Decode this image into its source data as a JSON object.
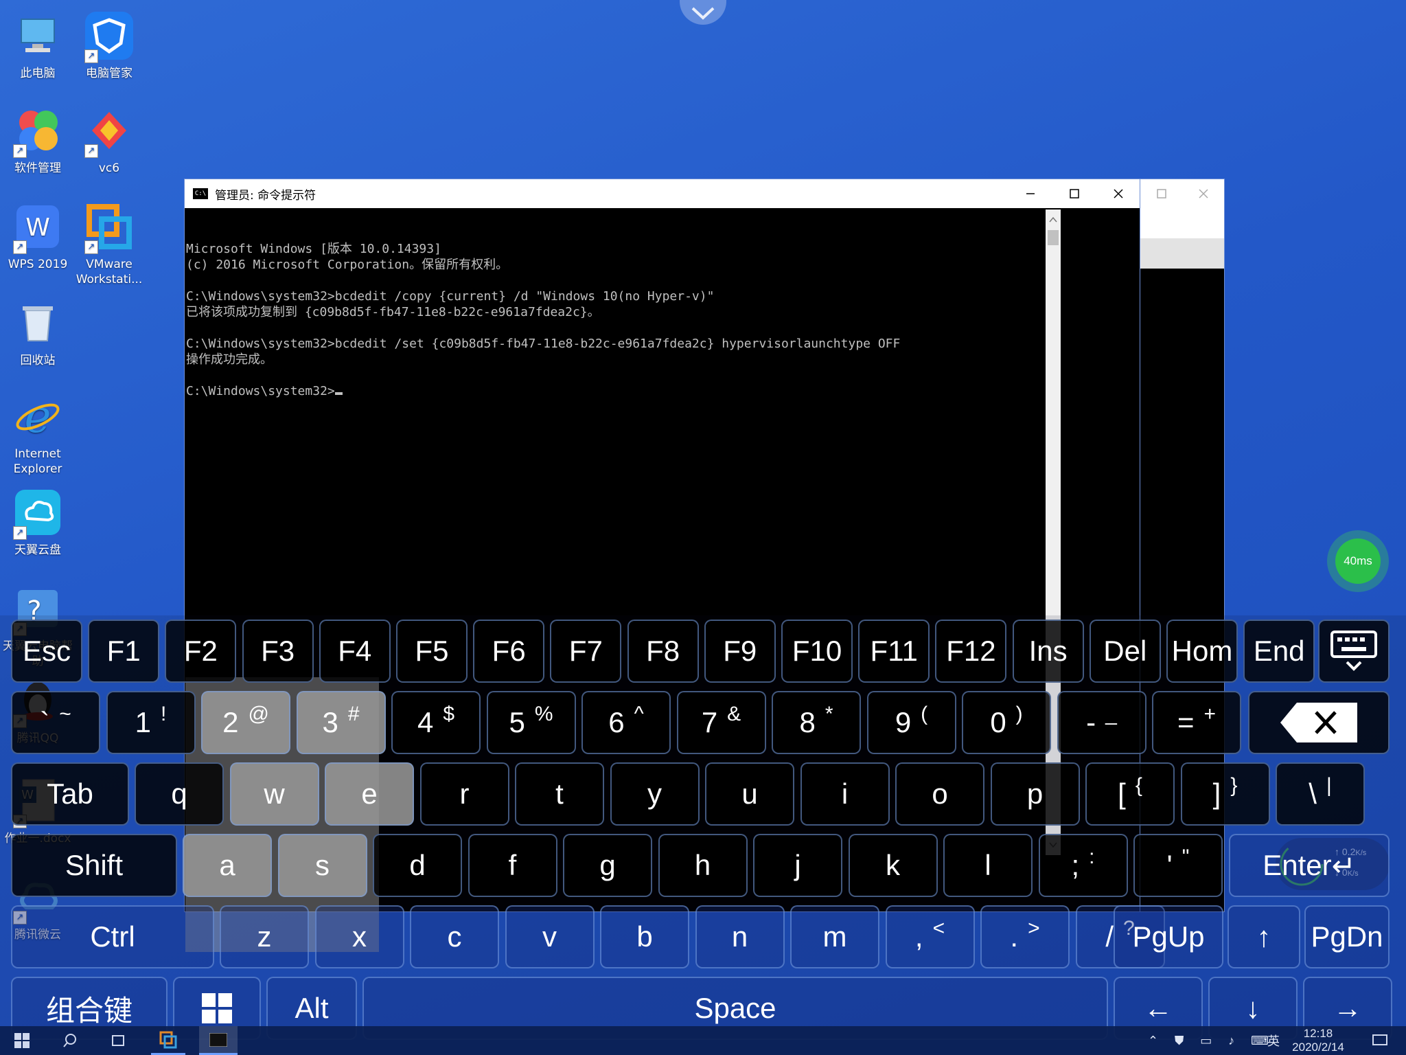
{
  "desktop": {
    "icons": [
      {
        "label": "此电脑"
      },
      {
        "label": "电脑管家"
      },
      {
        "label": "软件管理"
      },
      {
        "label": "vc6"
      },
      {
        "label": "WPS 2019"
      },
      {
        "label": "VMware Workstati..."
      },
      {
        "label": "回收站"
      },
      {
        "label": "Internet Explorer"
      },
      {
        "label": "天翼云盘"
      },
      {
        "label": "天翼云电脑帮助"
      },
      {
        "label": "腾讯QQ"
      },
      {
        "label": "作业一.docx"
      },
      {
        "label": "腾讯微云"
      }
    ]
  },
  "cmd_window": {
    "title": "管理员: 命令提示符",
    "lines": [
      "Microsoft Windows [版本 10.0.14393]",
      "(c) 2016 Microsoft Corporation。保留所有权利。",
      "",
      "C:\\Windows\\system32>bcdedit /copy {current} /d \"Windows 10(no Hyper-v)\"",
      "已将该项成功复制到 {c09b8d5f-fb47-11e8-b22c-e961a7fdea2c}。",
      "",
      "C:\\Windows\\system32>bcdedit /set {c09b8d5f-fb47-11e8-b22c-e961a7fdea2c} hypervisorlaunchtype OFF",
      "操作成功完成。",
      ""
    ],
    "prompt": "C:\\Windows\\system32>"
  },
  "ping": {
    "label": "40ms"
  },
  "network": {
    "up": "0.2",
    "up_unit": "K/s",
    "down": "0",
    "down_unit": "K/s"
  },
  "keyboard": {
    "row1": [
      "Esc",
      "F1",
      "F2",
      "F3",
      "F4",
      "F5",
      "F6",
      "F7",
      "F8",
      "F9",
      "F10",
      "F11",
      "F12",
      "Ins",
      "Del",
      "Hom",
      "End"
    ],
    "row2": [
      [
        "`",
        "~"
      ],
      [
        "1",
        "!"
      ],
      [
        "2",
        "@"
      ],
      [
        "3",
        "#"
      ],
      [
        "4",
        "$"
      ],
      [
        "5",
        "%"
      ],
      [
        "6",
        "^"
      ],
      [
        "7",
        "&"
      ],
      [
        "8",
        "*"
      ],
      [
        "9",
        "("
      ],
      [
        "0",
        ")"
      ],
      [
        "-",
        "_"
      ],
      [
        "=",
        "+"
      ]
    ],
    "row3_tab": "Tab",
    "row3": [
      [
        "q",
        ""
      ],
      [
        "w",
        ""
      ],
      [
        "e",
        ""
      ],
      [
        "r",
        ""
      ],
      [
        "t",
        ""
      ],
      [
        "y",
        ""
      ],
      [
        "u",
        ""
      ],
      [
        "i",
        ""
      ],
      [
        "o",
        ""
      ],
      [
        "p",
        ""
      ],
      [
        "[",
        "{"
      ],
      [
        "]",
        "}"
      ],
      [
        "\\",
        "|"
      ]
    ],
    "row4_shift": "Shift",
    "row4": [
      [
        "a",
        ""
      ],
      [
        "s",
        ""
      ],
      [
        "d",
        ""
      ],
      [
        "f",
        ""
      ],
      [
        "g",
        ""
      ],
      [
        "h",
        ""
      ],
      [
        "j",
        ""
      ],
      [
        "k",
        ""
      ],
      [
        "l",
        ""
      ],
      [
        ";",
        ":"
      ],
      [
        "'",
        "\""
      ]
    ],
    "row4_enter": "Enter",
    "row5_ctrl": "Ctrl",
    "row5": [
      [
        "z",
        ""
      ],
      [
        "x",
        ""
      ],
      [
        "c",
        ""
      ],
      [
        "v",
        ""
      ],
      [
        "b",
        ""
      ],
      [
        "n",
        ""
      ],
      [
        "m",
        ""
      ],
      [
        ",",
        "<"
      ],
      [
        ".",
        ">"
      ],
      [
        "/",
        "?"
      ]
    ],
    "pgup": "PgUp",
    "up_arrow": "↑",
    "pgdn": "PgDn",
    "combo": "组合键",
    "alt": "Alt",
    "space": "Space",
    "left_arrow": "←",
    "down_arrow": "↓",
    "right_arrow": "→"
  },
  "taskbar": {
    "ime": "英",
    "time": "12:18",
    "date": "2020/2/14"
  }
}
